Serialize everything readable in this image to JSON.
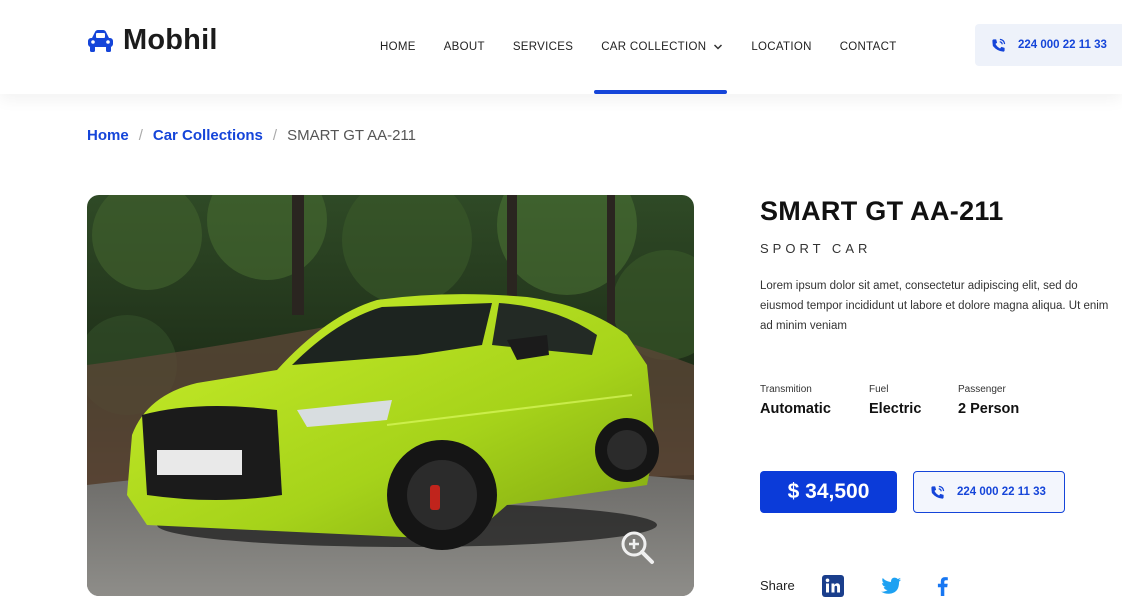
{
  "brand": {
    "name": "Mobhil",
    "color": "#1545d9"
  },
  "nav": {
    "items": [
      {
        "label": "HOME"
      },
      {
        "label": "ABOUT"
      },
      {
        "label": "SERVICES"
      },
      {
        "label": "CAR COLLECTION",
        "active": true,
        "has_dropdown": true
      },
      {
        "label": "LOCATION"
      },
      {
        "label": "CONTACT"
      }
    ],
    "phone": "224 000 22 11 33"
  },
  "breadcrumb": {
    "home": "Home",
    "collections": "Car Collections",
    "current": "SMART GT AA-211"
  },
  "product": {
    "title": "SMART GT AA-211",
    "category": "SPORT CAR",
    "description": "Lorem ipsum dolor sit amet, consectetur adipiscing elit, sed do eiusmod tempor incididunt ut labore et dolore magna aliqua. Ut enim ad minim veniam",
    "specs": [
      {
        "label": "Transmition",
        "value": "Automatic"
      },
      {
        "label": "Fuel",
        "value": "Electric"
      },
      {
        "label": "Passenger",
        "value": "2 Person"
      }
    ],
    "price": "$ 34,500",
    "phone": "224 000 22 11 33",
    "share_label": "Share",
    "social": [
      "linkedin-icon",
      "twitter-icon",
      "facebook-icon"
    ],
    "image": "lime-green-sedan-photo"
  }
}
